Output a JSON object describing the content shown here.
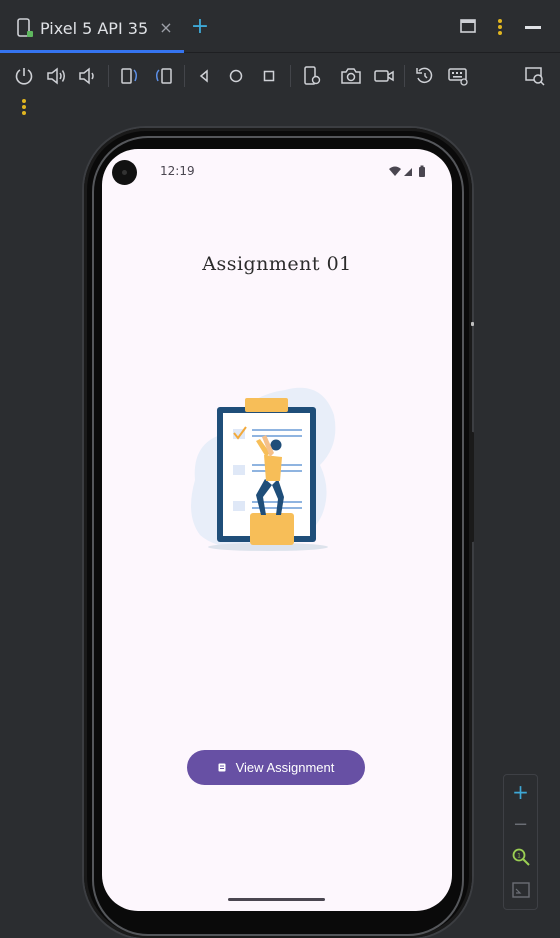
{
  "tab": {
    "title": "Pixel 5 API 35",
    "close": "×",
    "add": "+"
  },
  "toolbar": {
    "icons": [
      "power-icon",
      "volume-up-icon",
      "volume-down-icon",
      "rotate-left-icon",
      "rotate-right-icon",
      "back-icon",
      "home-icon",
      "overview-icon",
      "device-settings-icon",
      "screenshot-icon",
      "screen-record-icon",
      "snapshot-icon",
      "keyboard-icon",
      "display-settings-icon",
      "more-icon"
    ]
  },
  "device": {
    "status_time": "12:19",
    "title": "Assignment 01",
    "button_label": "View Assignment"
  },
  "zoom": {
    "zoom_in": "+",
    "zoom_out": "−"
  },
  "colors": {
    "accent": "#3574f0",
    "button": "#6750a4",
    "screen_bg": "#fdf7fd"
  }
}
